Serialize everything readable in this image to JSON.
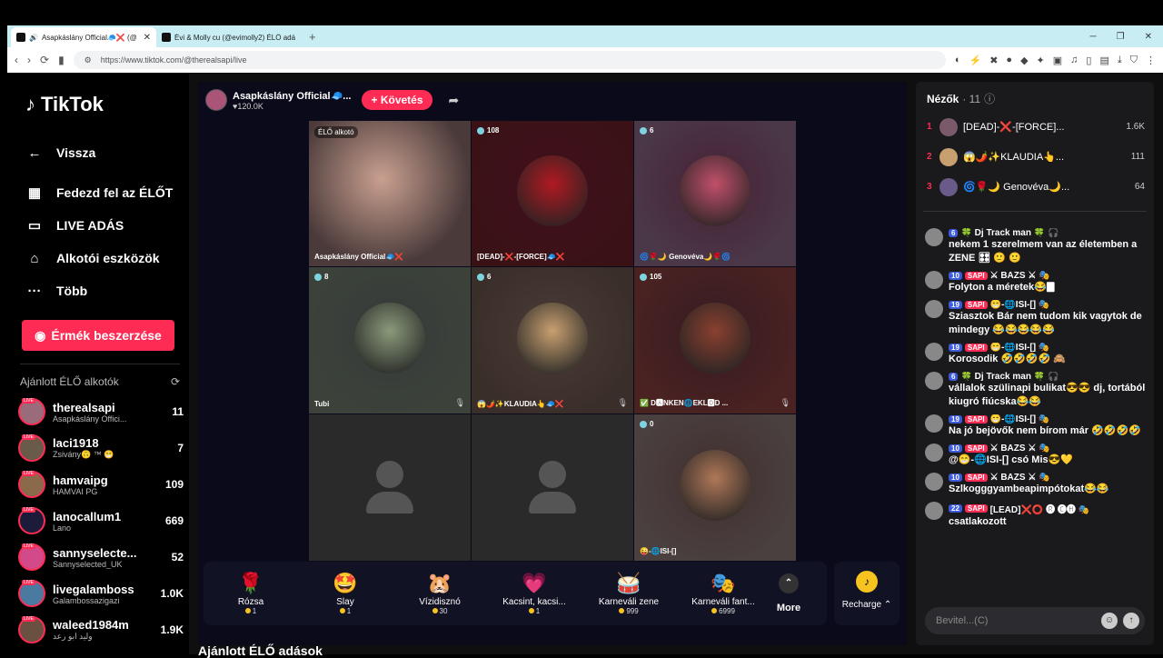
{
  "browser": {
    "tabs": [
      {
        "title": "Asapkáslány Official🧢❌ (@",
        "active": true
      },
      {
        "title": "Évi & Molly cu (@evimolly2) ÉLŐ adá",
        "active": false
      }
    ],
    "new_tab": "+",
    "url": "https://www.tiktok.com/@therealsapi/live"
  },
  "sidebar": {
    "logo": "TikTok",
    "back": "Vissza",
    "nav": [
      {
        "icon": "calendar-icon",
        "label": "Fedezd fel az ÉLŐT"
      },
      {
        "icon": "camera-icon",
        "label": "LIVE ADÁS"
      },
      {
        "icon": "house-icon",
        "label": "Alkotói eszközök"
      },
      {
        "icon": "more-icon",
        "label": "Több"
      }
    ],
    "coins_button": "Érmék beszerzése",
    "recommended_title": "Ajánlott ÉLŐ alkotók",
    "creators": [
      {
        "name": "therealsapi",
        "sub": "Asapkáslány Offici...",
        "count": "11",
        "color": "#9a6b7a"
      },
      {
        "name": "laci1918",
        "sub": "Zsivány🙃 ™ 😁",
        "count": "7",
        "color": "#6a5a4a"
      },
      {
        "name": "hamvaipg",
        "sub": "HAMVAI PG",
        "count": "109",
        "color": "#8a6a4a"
      },
      {
        "name": "lanocallum1",
        "sub": "Lano",
        "count": "669",
        "color": "#1c1c3a"
      },
      {
        "name": "sannyselecte...",
        "sub": "Sannyselected_UK",
        "count": "52",
        "color": "#d24a8a"
      },
      {
        "name": "livegalamboss",
        "sub": "Galambossazigazi",
        "count": "1.0K",
        "color": "#4a7aa0"
      },
      {
        "name": "waleed1984m",
        "sub": "وليد ابو رعد",
        "count": "1.9K",
        "color": "#6a5040"
      }
    ]
  },
  "stream": {
    "host_name": "Asapkáslány Official🧢...",
    "host_viewers": "♥120.0K",
    "follow_label": "+ Követés",
    "cells": [
      {
        "badge": "ÉLŐ alkotó",
        "count": "",
        "name": "Asapkáslány Official🧢❌",
        "mic": false,
        "type": "photo",
        "bg": "#5e5554",
        "circ": ""
      },
      {
        "badge": "",
        "count": "108",
        "name": "[DEAD]-❌-[FORCE]🧢❌",
        "mic": false,
        "type": "avatar",
        "bg": "#3a1216",
        "circ": "#b01a22"
      },
      {
        "badge": "",
        "count": "6",
        "name": "🌀🌹🌙 Genovéva🌙🌹🌀",
        "mic": false,
        "type": "avatar",
        "bg": "#4a3848",
        "circ": "#c1506a"
      },
      {
        "badge": "",
        "count": "8",
        "name": "Tubi",
        "mic": true,
        "type": "avatar",
        "bg": "#3c423a",
        "circ": "#8a9a7a"
      },
      {
        "badge": "",
        "count": "6",
        "name": "😱🌶️✨KLAUDIA👆🧢❌",
        "mic": true,
        "type": "avatar",
        "bg": "#3a2e2a",
        "circ": "#c8a070"
      },
      {
        "badge": "",
        "count": "105",
        "name": "✅ D🅰NKEN🌐EKL🅾D ...",
        "mic": true,
        "type": "avatar",
        "bg": "#4a2222",
        "circ": "#8a4030"
      },
      {
        "badge": "",
        "count": "",
        "name": "",
        "mic": false,
        "type": "empty",
        "bg": "#2b2b2b",
        "circ": ""
      },
      {
        "badge": "",
        "count": "",
        "name": "",
        "mic": false,
        "type": "empty",
        "bg": "#2b2b2b",
        "circ": ""
      },
      {
        "badge": "",
        "count": "0",
        "name": "😜-🌐ISI-[]",
        "mic": false,
        "type": "avatar",
        "bg": "#4a4040",
        "circ": "#b07858"
      }
    ]
  },
  "gifts": [
    {
      "icon": "🌹",
      "name": "Rózsa",
      "price": "1"
    },
    {
      "icon": "🤩",
      "name": "Slay",
      "price": "1"
    },
    {
      "icon": "🐹",
      "name": "Vízidisznó",
      "price": "30"
    },
    {
      "icon": "💗",
      "name": "Kacsint, kacsi...",
      "price": "1"
    },
    {
      "icon": "🥁",
      "name": "Karneváli zene",
      "price": "999"
    },
    {
      "icon": "🎭",
      "name": "Karneváli fant...",
      "price": "6999"
    }
  ],
  "more_label": "More",
  "recharge_label": "Recharge ⌃",
  "bottom_title": "Ajánlott ÉLŐ adások",
  "chat": {
    "title": "Nézők",
    "count": "· 11",
    "ranking": [
      {
        "rank": "1",
        "name": "[DEAD]-❌-[FORCE]...",
        "value": "1.6K"
      },
      {
        "rank": "2",
        "name": "😱🌶️✨KLAUDIA👆...",
        "value": "111"
      },
      {
        "rank": "3",
        "name": "🌀🌹🌙 Genovéva🌙...",
        "value": "64"
      }
    ],
    "messages": [
      {
        "lvl": "6",
        "sapi": "",
        "user": "🍀 Dj Track man 🍀 🎧",
        "text": "nekem 1 szerelmem van az életemben a ZENE 🎛 🙂 🙂"
      },
      {
        "lvl": "10",
        "sapi": "SAPI",
        "user": "⚔ BAZS ⚔ 🎭",
        "text": "Folyton a méretek😂🀫"
      },
      {
        "lvl": "19",
        "sapi": "SAPI",
        "user": "😁-🌐ISI-[] 🎭",
        "text": "Sziasztok Bár nem tudom kik vagytok de mindegy 😂😂😂😂😂"
      },
      {
        "lvl": "19",
        "sapi": "SAPI",
        "user": "😁-🌐ISI-[] 🎭",
        "text": "Korosodik 🤣🤣🤣🤣 🙈"
      },
      {
        "lvl": "6",
        "sapi": "",
        "user": "🍀 Dj Track man 🍀 🎧",
        "text": "vállalok szülinapi bulikat😎😎 dj, tortából kiugró fiúcska😂😂"
      },
      {
        "lvl": "19",
        "sapi": "SAPI",
        "user": "😁-🌐ISI-[] 🎭",
        "text": "Na jó bejövők nem bírom már 🤣🤣🤣🤣"
      },
      {
        "lvl": "10",
        "sapi": "SAPI",
        "user": "⚔ BAZS ⚔ 🎭",
        "text": "@😁-🌐ISI-[] csó Mis😎💛"
      },
      {
        "lvl": "10",
        "sapi": "SAPI",
        "user": "⚔ BAZS ⚔ 🎭",
        "text": "Szlkogggyambeapimpótokat😂😂"
      },
      {
        "lvl": "22",
        "sapi": "SAPI",
        "user": "[LEAD]❌⭕ 🅡 🅒🅗 🎭",
        "text": "csatlakozott"
      }
    ],
    "input_placeholder": "Bevitel...(C)"
  }
}
